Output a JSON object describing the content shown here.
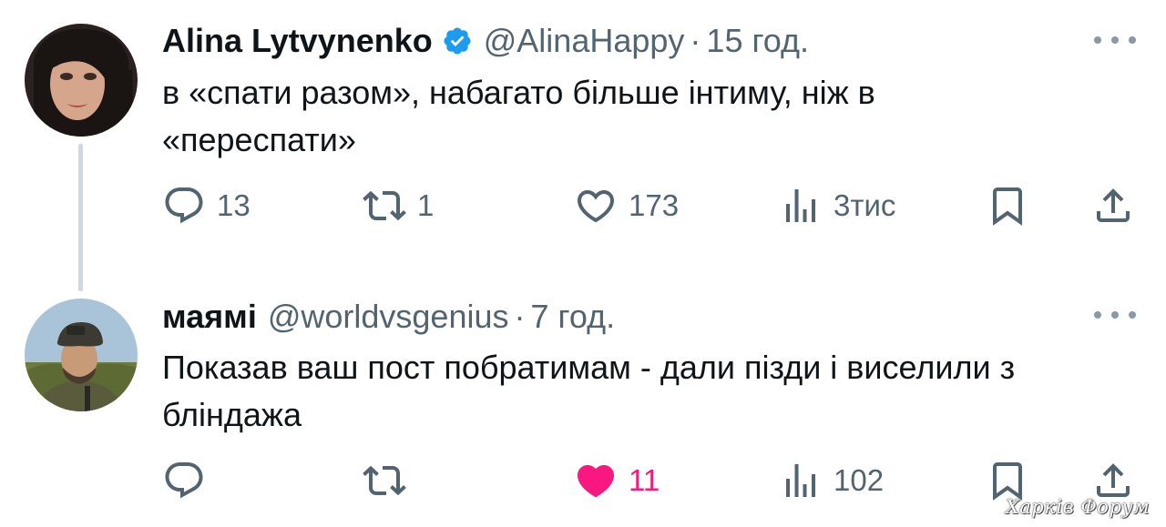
{
  "tweets": [
    {
      "author_name": "Alina Lytvynenko",
      "verified": true,
      "handle": "@AlinaHappy",
      "separator": "·",
      "time": "15 год.",
      "text": "в «спати разом», набагато більше інтиму, ніж в «переспати»",
      "reply_count": "13",
      "retweet_count": "1",
      "like_count": "173",
      "views_count": "3тис",
      "liked": false
    },
    {
      "author_name": "маямі",
      "verified": false,
      "handle": "@worldvsgenius",
      "separator": "·",
      "time": "7 год.",
      "text": "Показав ваш пост побратимам - дали пізди і виселили з бліндажа",
      "reply_count": "",
      "retweet_count": "",
      "like_count": "11",
      "views_count": "102",
      "liked": true
    }
  ],
  "watermark": "Харків Форум",
  "colors": {
    "text": "#0f1419",
    "secondary": "#536471",
    "verified": "#1d9bf0",
    "like_active": "#f91880",
    "thread_line": "#cfd9de"
  },
  "icons": [
    "reply-icon",
    "retweet-icon",
    "like-icon",
    "views-icon",
    "bookmark-icon",
    "share-icon",
    "verified-badge-icon",
    "more-icon"
  ]
}
